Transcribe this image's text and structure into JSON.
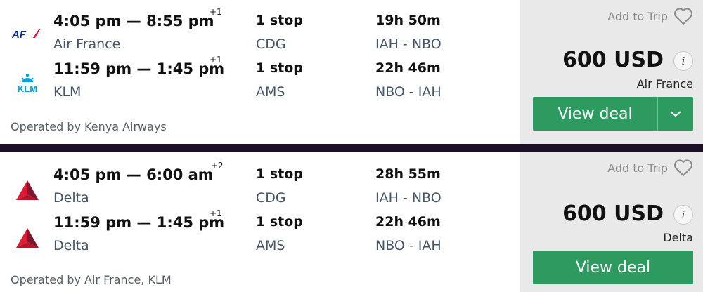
{
  "results": [
    {
      "legs": [
        {
          "logo": "air-france-logo",
          "logo_text": "AF",
          "depart": "4:05 pm",
          "dash": "—",
          "arrive": "8:55 pm",
          "day_offset": "+1",
          "airline": "Air France",
          "stops": "1 stop",
          "via": "CDG",
          "duration": "19h 50m",
          "route": "IAH - NBO"
        },
        {
          "logo": "klm-logo",
          "logo_text": "KLM",
          "depart": "11:59 pm",
          "dash": "—",
          "arrive": "1:45 pm",
          "day_offset": "+1",
          "airline": "KLM",
          "stops": "1 stop",
          "via": "AMS",
          "duration": "22h 46m",
          "route": "NBO - IAH"
        }
      ],
      "operated_by": "Operated by Kenya Airways",
      "add_to_trip": "Add to Trip",
      "price": "600 USD",
      "info": "i",
      "provider": "Air France",
      "cta": "View deal"
    },
    {
      "legs": [
        {
          "logo": "delta-logo",
          "depart": "4:05 pm",
          "dash": "—",
          "arrive": "6:00 am",
          "day_offset": "+2",
          "airline": "Delta",
          "stops": "1 stop",
          "via": "CDG",
          "duration": "28h 55m",
          "route": "IAH - NBO"
        },
        {
          "logo": "delta-logo",
          "depart": "11:59 pm",
          "dash": "—",
          "arrive": "1:45 pm",
          "day_offset": "+1",
          "airline": "Delta",
          "stops": "1 stop",
          "via": "AMS",
          "duration": "22h 46m",
          "route": "NBO - IAH"
        }
      ],
      "operated_by": "Operated by Air France, KLM",
      "add_to_trip": "Add to Trip",
      "price": "600 USD",
      "info": "i",
      "provider": "Delta",
      "cta": "View deal"
    }
  ],
  "colors": {
    "accent_green": "#2d9a5f",
    "divider": "#1d0e2a",
    "panel": "#e9e9e9",
    "muted_text": "#445566"
  }
}
